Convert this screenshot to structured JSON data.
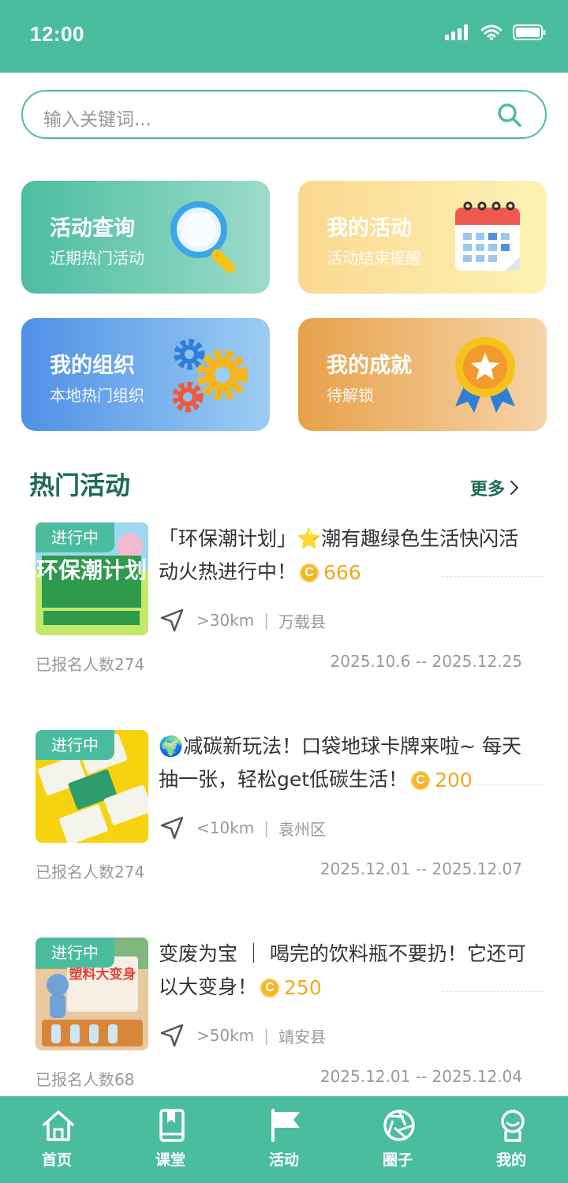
{
  "status_bar": {
    "time": "12:00"
  },
  "search": {
    "placeholder": "输入关键词..."
  },
  "cards": [
    {
      "title": "活动查询",
      "subtitle": "近期热门活动",
      "icon": "magnifier-icon"
    },
    {
      "title": "我的活动",
      "subtitle": "活动结束提醒",
      "icon": "calendar-icon"
    },
    {
      "title": "我的组织",
      "subtitle": "本地热门组织",
      "icon": "gears-icon"
    },
    {
      "title": "我的成就",
      "subtitle": "待解锁",
      "icon": "medal-icon"
    }
  ],
  "section": {
    "title": "热门活动",
    "more": "更多"
  },
  "activities": [
    {
      "badge": "进行中",
      "title": "「环保潮计划」⭐潮有趣绿色生活快闪活动火热进行中！",
      "points": "666",
      "distance": ">30km",
      "place": "万载县",
      "signups": "已报名人数274",
      "date": "2025.10.6 -- 2025.12.25",
      "thumb_text": "环保潮计划"
    },
    {
      "badge": "进行中",
      "title": "🌍减碳新玩法！口袋地球卡牌来啦~ 每天抽一张，轻松get低碳生活！",
      "points": "200",
      "distance": "<10km",
      "place": "袁州区",
      "signups": "已报名人数274",
      "date": "2025.12.01 -- 2025.12.07"
    },
    {
      "badge": "进行中",
      "title": "变废为宝 ｜ 喝完的饮料瓶不要扔！它还可以大变身！",
      "points": "250",
      "distance": ">50km",
      "place": "靖安县",
      "signups": "已报名人数68",
      "date": "2025.12.01 -- 2025.12.04",
      "thumb_text": "塑料大变身"
    }
  ],
  "coin_symbol": "C",
  "tabbar": [
    {
      "label": "首页",
      "icon": "home-icon"
    },
    {
      "label": "课堂",
      "icon": "book-icon"
    },
    {
      "label": "活动",
      "icon": "flag-icon",
      "active": true
    },
    {
      "label": "圈子",
      "icon": "aperture-icon"
    },
    {
      "label": "我的",
      "icon": "user-icon"
    }
  ],
  "colors": {
    "primary": "#4bbd9f",
    "accent": "#f0a91c",
    "title": "#1e6b55"
  }
}
